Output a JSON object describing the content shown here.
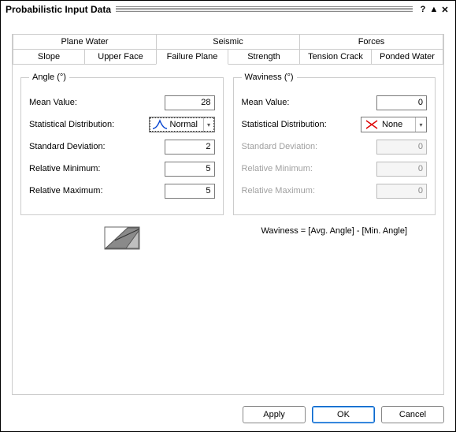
{
  "title": "Probabilistic Input Data",
  "titlebar": {
    "help": "?",
    "up": "▲",
    "close": "✕"
  },
  "tabs_top": [
    "Plane Water",
    "Seismic",
    "Forces"
  ],
  "tabs_bottom": [
    "Slope",
    "Upper Face",
    "Failure Plane",
    "Strength",
    "Tension Crack",
    "Ponded Water"
  ],
  "active_tab": "Failure Plane",
  "angle": {
    "legend": "Angle (°)",
    "mean_label": "Mean Value:",
    "mean_value": "28",
    "dist_label": "Statistical Distribution:",
    "dist_value": "Normal",
    "std_label": "Standard Deviation:",
    "std_value": "2",
    "relmin_label": "Relative Minimum:",
    "relmin_value": "5",
    "relmax_label": "Relative Maximum:",
    "relmax_value": "5"
  },
  "waviness": {
    "legend": "Waviness (°)",
    "mean_label": "Mean Value:",
    "mean_value": "0",
    "dist_label": "Statistical Distribution:",
    "dist_value": "None",
    "std_label": "Standard Deviation:",
    "std_value": "0",
    "relmin_label": "Relative Minimum:",
    "relmin_value": "0",
    "relmax_label": "Relative Maximum:",
    "relmax_value": "0"
  },
  "formula": "Waviness = [Avg. Angle] - [Min. Angle]",
  "buttons": {
    "apply": "Apply",
    "ok": "OK",
    "cancel": "Cancel"
  }
}
